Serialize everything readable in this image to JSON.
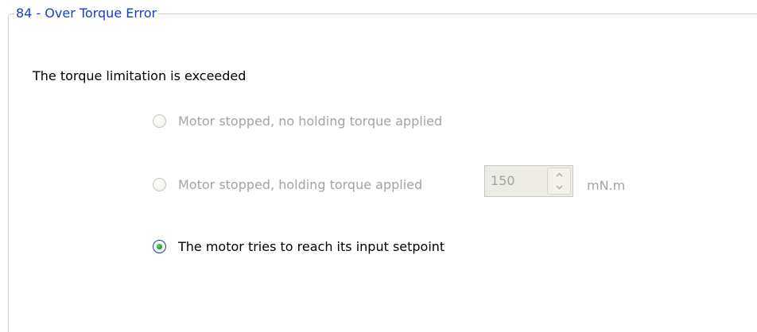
{
  "group": {
    "title": "84 - Over Torque Error"
  },
  "description": "The torque limitation is exceeded",
  "options": [
    {
      "label": "Motor stopped, no holding torque applied",
      "selected": false,
      "enabled": false
    },
    {
      "label": "Motor stopped, holding torque applied",
      "selected": false,
      "enabled": false
    },
    {
      "label": "The motor tries to reach its input setpoint",
      "selected": true,
      "enabled": true
    }
  ],
  "holding_torque": {
    "value": "150",
    "unit": "mN.m",
    "enabled": false
  },
  "colors": {
    "group_title": "#1a3cc8",
    "disabled_text": "#a4a49e",
    "selected_dot": "#24a024"
  },
  "icons": {
    "spin_up": "chevron-up-icon",
    "spin_down": "chevron-down-icon"
  }
}
